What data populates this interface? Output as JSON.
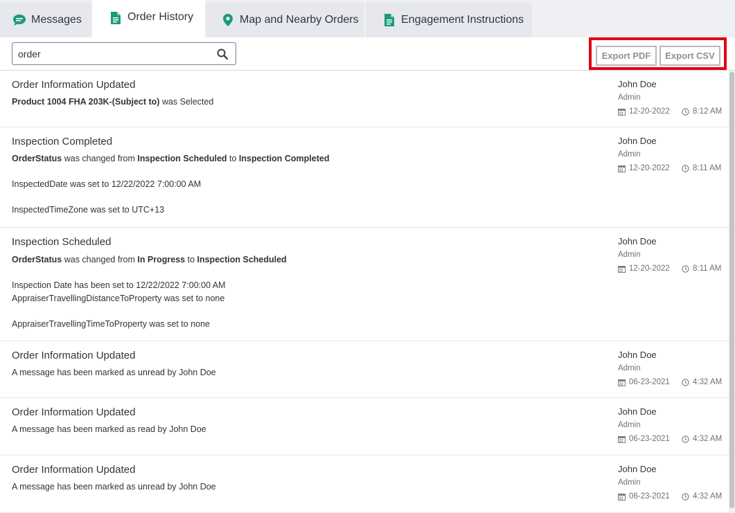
{
  "tabs": {
    "messages": "Messages",
    "order_history": "Order History",
    "map": "Map and Nearby Orders",
    "engagement": "Engagement Instructions"
  },
  "search": {
    "value": "order",
    "placeholder": ""
  },
  "export": {
    "pdf": "Export PDF",
    "csv": "Export CSV"
  },
  "colors": {
    "accent": "#1a9a7a",
    "highlight": "#e3000f"
  },
  "icons": {
    "messages": "chat-bubble-icon",
    "order_history": "document-icon",
    "map": "map-pin-icon",
    "engagement": "document-icon",
    "search": "search-icon",
    "date": "calendar-icon",
    "time": "clock-icon"
  },
  "entries": [
    {
      "title": "Order Information Updated",
      "lines": [
        {
          "b1": "Product 1004 FHA 203K-(Subject to)",
          "t1": " was Selected"
        }
      ],
      "user": "John Doe",
      "role": "Admin",
      "date": "12-20-2022",
      "time": "8:12 AM"
    },
    {
      "title": "Inspection Completed",
      "lines": [
        {
          "b1": "OrderStatus",
          "t1": " was changed from ",
          "b2": "Inspection Scheduled",
          "t2": " to ",
          "b3": "Inspection Completed"
        },
        {
          "t1": "InspectedDate was set to 12/22/2022 7:00:00 AM"
        },
        {
          "t1": "InspectedTimeZone was set to UTC+13"
        }
      ],
      "user": "John Doe",
      "role": "Admin",
      "date": "12-20-2022",
      "time": "8:11 AM"
    },
    {
      "title": "Inspection Scheduled",
      "lines": [
        {
          "b1": "OrderStatus",
          "t1": " was changed from ",
          "b2": "In Progress",
          "t2": " to ",
          "b3": "Inspection Scheduled"
        },
        {
          "t1": "Inspection Date has been set to 12/22/2022 7:00:00 AM"
        },
        {
          "t1": "AppraiserTravellingDistanceToProperty was set to none"
        },
        {
          "t1": "AppraiserTravellingTimeToProperty was set to none"
        }
      ],
      "user": "John Doe",
      "role": "Admin",
      "date": "12-20-2022",
      "time": "8:11 AM"
    },
    {
      "title": "Order Information Updated",
      "lines": [
        {
          "t1": "A message has been marked as unread by John Doe"
        }
      ],
      "user": "John Doe",
      "role": "Admin",
      "date": "06-23-2021",
      "time": "4:32 AM"
    },
    {
      "title": "Order Information Updated",
      "lines": [
        {
          "t1": "A message has been marked as read by John Doe"
        }
      ],
      "user": "John Doe",
      "role": "Admin",
      "date": "06-23-2021",
      "time": "4:32 AM"
    },
    {
      "title": "Order Information Updated",
      "lines": [
        {
          "t1": "A message has been marked as unread by John Doe"
        }
      ],
      "user": "John Doe",
      "role": "Admin",
      "date": "06-23-2021",
      "time": "4:32 AM"
    }
  ]
}
